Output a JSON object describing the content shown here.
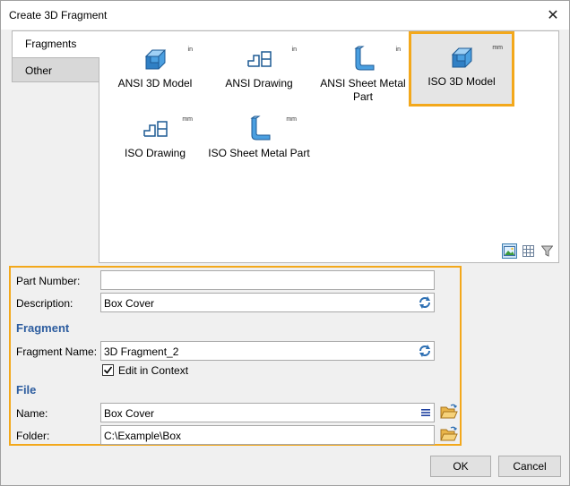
{
  "window": {
    "title": "Create 3D Fragment",
    "close_glyph": "✕"
  },
  "tabs": [
    {
      "label": "Fragments",
      "active": true
    },
    {
      "label": "Other",
      "active": false
    }
  ],
  "templates": [
    {
      "label": "ANSI 3D Model",
      "unit": "in",
      "icon": "3d-model-icon",
      "selected": false
    },
    {
      "label": "ANSI Drawing",
      "unit": "in",
      "icon": "drawing-icon",
      "selected": false
    },
    {
      "label": "ANSI Sheet Metal Part",
      "unit": "in",
      "icon": "sheet-metal-icon",
      "selected": false
    },
    {
      "label": "ISO 3D Model",
      "unit": "mm",
      "icon": "3d-model-icon",
      "selected": true
    },
    {
      "label": "ISO Drawing",
      "unit": "mm",
      "icon": "drawing-icon",
      "selected": false
    },
    {
      "label": "ISO Sheet Metal Part",
      "unit": "mm",
      "icon": "sheet-metal-icon",
      "selected": false
    }
  ],
  "form": {
    "part_number_label": "Part Number:",
    "part_number_value": "",
    "description_label": "Description:",
    "description_value": "Box Cover",
    "fragment_section": "Fragment",
    "fragment_name_label": "Fragment Name:",
    "fragment_name_value": "3D Fragment_2",
    "edit_in_context_label": "Edit in Context",
    "edit_in_context_checked": true,
    "file_section": "File",
    "name_label": "Name:",
    "name_value": "Box Cover",
    "folder_label": "Folder:",
    "folder_value": "C:\\Example\\Box"
  },
  "buttons": {
    "ok": "OK",
    "cancel": "Cancel"
  },
  "colors": {
    "highlight": "#f3a81b",
    "section": "#2d5d9f",
    "icon_blue": "#4a9fe0"
  }
}
